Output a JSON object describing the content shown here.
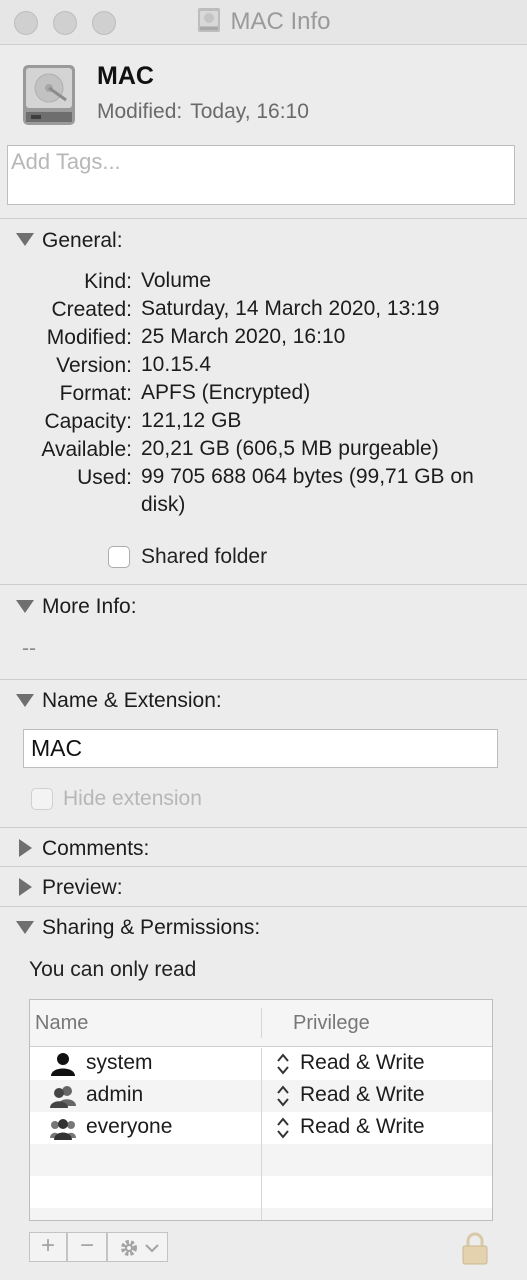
{
  "window": {
    "title": "MAC Info"
  },
  "header": {
    "name": "MAC",
    "modified_label": "Modified:",
    "modified_value": "Today, 16:10"
  },
  "tags": {
    "placeholder": "Add Tags..."
  },
  "general": {
    "title": "General:",
    "rows": [
      {
        "label": "Kind:",
        "value": "Volume"
      },
      {
        "label": "Created:",
        "value": "Saturday, 14 March 2020, 13:19"
      },
      {
        "label": "Modified:",
        "value": "25 March 2020, 16:10"
      },
      {
        "label": "Version:",
        "value": "10.15.4"
      },
      {
        "label": "Format:",
        "value": "APFS (Encrypted)"
      },
      {
        "label": "Capacity:",
        "value": "121,12 GB"
      },
      {
        "label": "Available:",
        "value": "20,21 GB (606,5 MB purgeable)"
      },
      {
        "label": "Used:",
        "value": "99 705 688 064 bytes (99,71 GB on disk)"
      }
    ],
    "shared_folder_label": "Shared folder",
    "shared_folder_checked": false
  },
  "more_info": {
    "title": "More Info:",
    "value": "--"
  },
  "name_extension": {
    "title": "Name & Extension:",
    "name_value": "MAC",
    "hide_extension_label": "Hide extension",
    "hide_extension_checked": false
  },
  "comments": {
    "title": "Comments:"
  },
  "preview": {
    "title": "Preview:"
  },
  "sharing": {
    "title": "Sharing & Permissions:",
    "status": "You can only read",
    "columns": {
      "name": "Name",
      "privilege": "Privilege"
    },
    "rows": [
      {
        "name": "system",
        "privilege": "Read & Write",
        "icon": "single-user-icon"
      },
      {
        "name": "admin",
        "privilege": "Read & Write",
        "icon": "group-icon"
      },
      {
        "name": "everyone",
        "privilege": "Read & Write",
        "icon": "everyone-group-icon"
      }
    ]
  },
  "toolbar": {
    "add": "+",
    "remove": "−",
    "action_icon": "gear-icon",
    "lock_icon": "lock-icon"
  },
  "colors": {
    "background": "#ececec",
    "text": "#1c1c1c",
    "disabled": "#b7b7b7"
  }
}
